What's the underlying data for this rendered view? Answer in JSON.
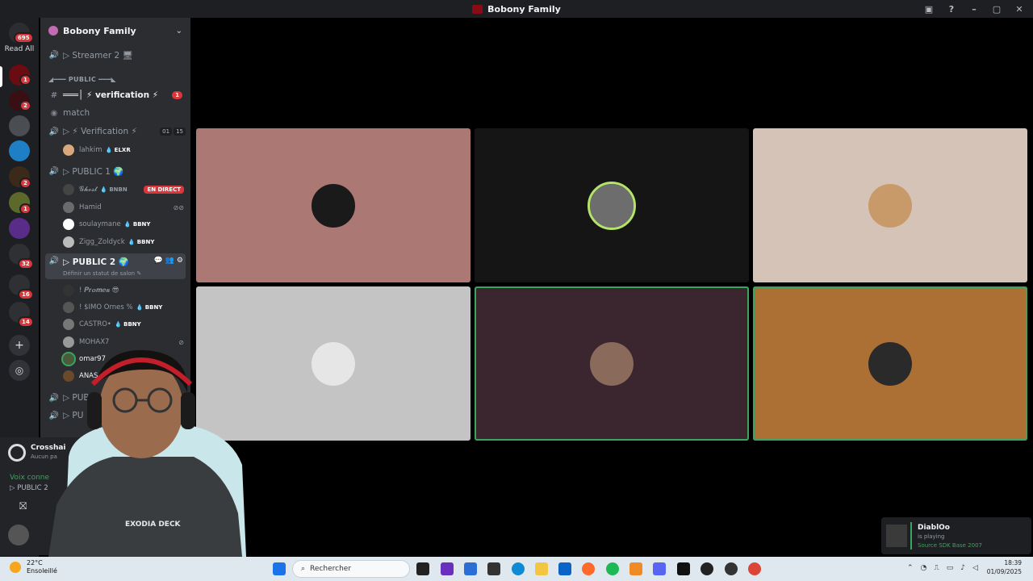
{
  "window": {
    "title": "Bobony Family"
  },
  "colors": {
    "accent_green": "#3ba55d",
    "badge_red": "#da373c",
    "sidebar": "#2b2d31",
    "rail": "#1e1f22"
  },
  "rail": {
    "read_all_label": "Read All",
    "read_all_badge": "695",
    "badges": [
      "1",
      "2",
      "2",
      "1",
      "32",
      "16",
      "14"
    ]
  },
  "guild": {
    "name": "Bobony Family"
  },
  "channels": {
    "streamer": "▷ Streamer 2 🖥",
    "category": "◢━━━ PUBLIC ━━━◣",
    "verification_text": "═══│ ⚡ verification ⚡",
    "verification_badge": "1",
    "match": "match",
    "verification_voice": "▷ ⚡ Verification ⚡",
    "verification_counts": [
      "01",
      "15"
    ],
    "public1": "▷ PUBLIC 1 🌍",
    "public2": "▷ PUBLIC 2 🌍",
    "public2_status": "Définir un statut de salon ✎",
    "public3": "▷ PUBLI",
    "public4": "▷ PU"
  },
  "users": {
    "verif": [
      {
        "name": "lahkim",
        "tag": "💧 ELXR"
      }
    ],
    "public1": [
      {
        "name": "𝓖𝓱𝓸𝓼𝓽",
        "tag": "💧 BNBN",
        "live": "EN DIRECT"
      },
      {
        "name": "Hamid",
        "tag": ""
      },
      {
        "name": "soulaymane",
        "tag": "💧 BBNY"
      },
      {
        "name": "Zigg_Zoldyck",
        "tag": "💧 BBNY"
      }
    ],
    "public2": [
      {
        "name": "! 𝑷𝒓𝒐𝒎𝒆𝒔 😎",
        "tag": ""
      },
      {
        "name": "! $IMO Ornes %",
        "tag": "💧 BBNY"
      },
      {
        "name": "CASTRO•",
        "tag": "💧 BBNY"
      },
      {
        "name": "MOHAX7",
        "tag": ""
      },
      {
        "name": "omar97",
        "tag": "💧"
      },
      {
        "name": "ANAS",
        "tag": ""
      }
    ]
  },
  "panel": {
    "activity_title": "Crosshai",
    "activity_sub": "Aucun pa",
    "voice_label": "Voix conne",
    "voice_channel": "▷ PUBLIC 2"
  },
  "webcam": {
    "shirt_text": "EXODIA DECK"
  },
  "toast": {
    "user": "DiablOo",
    "line1": "is playing",
    "game": "Source SDK Base 2007"
  },
  "taskbar": {
    "temperature": "22°C",
    "weather": "Ensoleillé",
    "search_placeholder": "Rechercher",
    "time": "18:39",
    "date": "01/09/2025"
  }
}
